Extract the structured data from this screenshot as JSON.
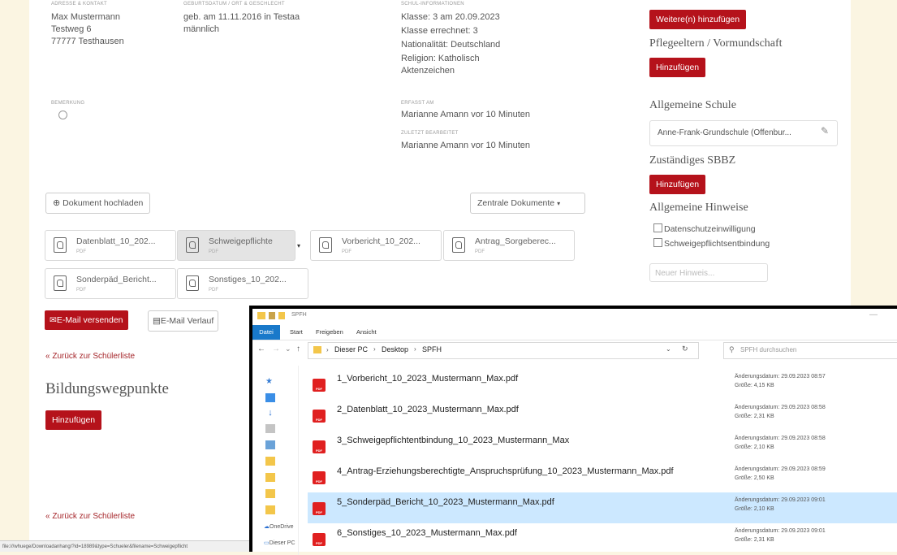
{
  "student": {
    "name": "Max Mustermann",
    "street": "Testweg 6",
    "city": "77777 Testhausen",
    "birth": "geb. am 11.11.2016 in Testaa",
    "gender": "männlich",
    "class": "Klasse: 3 am 20.09.2023",
    "class_calc": "Klasse errechnet: 3",
    "nationality": "Nationalität: Deutschland",
    "religion": "Religion: Katholisch",
    "file_number": "Aktenzeichen",
    "remark_label": "BEMERKUNG",
    "created_label": "ERFASST AM",
    "created_value": "Marianne Amann vor 10 Minuten",
    "edited_label": "ZULETZT BEARBEITET",
    "edited_value": "Marianne Amann vor 10 Minuten"
  },
  "right": {
    "add_more": "Weitere(n) hinzufügen",
    "foster_title": "Pflegeeltern / Vormundschaft",
    "add": "Hinzufügen",
    "school_title": "Allgemeine Schule",
    "school_value": "Anne-Frank-Grundschule (Offenbur...",
    "sbbz_title": "Zuständiges SBBZ",
    "hints_title": "Allgemeine Hinweise",
    "hint1": "Datenschutzeinwilligung",
    "hint2": "Schweigepflichtsentbindung",
    "new_hint_placeholder": "Neuer Hinweis..."
  },
  "docs": {
    "upload": "Dokument hochladen",
    "central": "Zentrale Dokumente",
    "pdf": "PDF",
    "items": [
      "Datenblatt_10_202...",
      "Schweigepflichte",
      "Vorbericht_10_202...",
      "Antrag_Sorgeberec...",
      "Sonderpäd_Bericht...",
      "Sonstiges_10_202..."
    ],
    "email_send": "E-Mail versenden",
    "email_history": "E-Mail Verlauf",
    "back": "« Zurück zur Schülerliste",
    "education_title": "Bildungswegpunkte",
    "add": "Hinzufügen"
  },
  "statusbar": "file:///whuege/Downloadanhang/?id=18989&type=Schueler&filename=Schweigepflicht",
  "explorer": {
    "title": "SPFH",
    "tabs": [
      "Datei",
      "Start",
      "Freigeben",
      "Ansicht"
    ],
    "path": [
      "Dieser PC",
      "Desktop",
      "SPFH"
    ],
    "search_placeholder": "SPFH durchsuchen",
    "date_label": "Änderungsdatum:",
    "size_label": "Größe:",
    "files": [
      {
        "name": "1_Vorbericht_10_2023_Mustermann_Max.pdf",
        "date": "29.09.2023 08:57",
        "size": "4,15 KB"
      },
      {
        "name": "2_Datenblatt_10_2023_Mustermann_Max.pdf",
        "date": "29.09.2023 08:58",
        "size": "2,31 KB"
      },
      {
        "name": "3_Schweigepflichtentbindung_10_2023_Mustermann_Max",
        "date": "29.09.2023 08:58",
        "size": "2,10 KB"
      },
      {
        "name": "4_Antrag-Erziehungsberechtigte_Anspruchsprüfung_10_2023_Mustermann_Max.pdf",
        "date": "29.09.2023 08:59",
        "size": "2,50 KB"
      },
      {
        "name": "5_Sonderpäd_Bericht_10_2023_Mustermann_Max.pdf",
        "date": "29.09.2023 09:01",
        "size": "2,10 KB"
      },
      {
        "name": "6_Sonstiges_10_2023_Mustermann_Max.pdf",
        "date": "29.09.2023 09:01",
        "size": "2,31 KB"
      }
    ],
    "nav_labels": [
      "OneDrive",
      "Dieser PC"
    ]
  }
}
